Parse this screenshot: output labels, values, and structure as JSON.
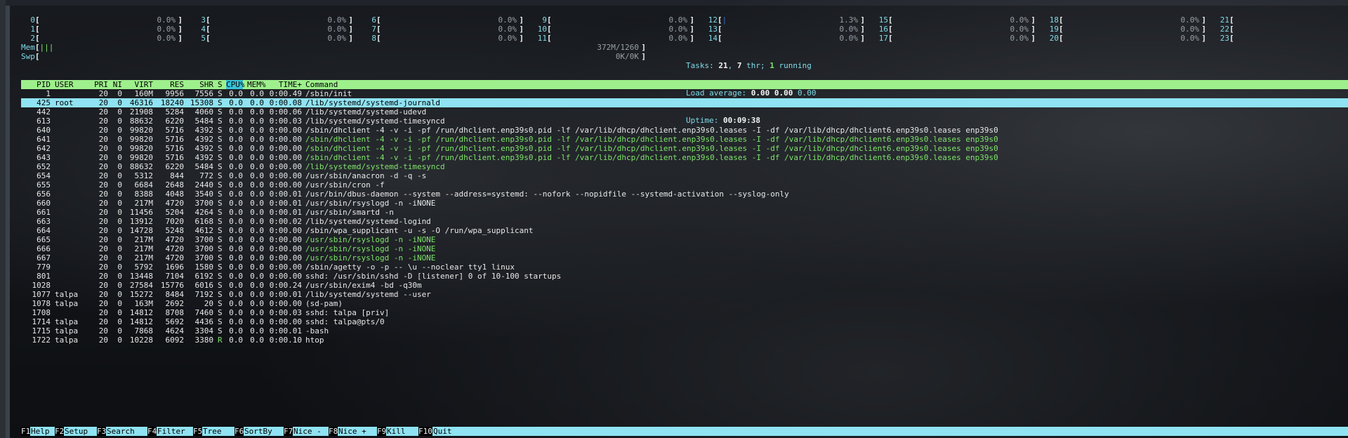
{
  "cpus": [
    {
      "id": "0",
      "val": "0.0%"
    },
    {
      "id": "1",
      "val": "0.0%"
    },
    {
      "id": "2",
      "val": "0.0%"
    },
    {
      "id": "3",
      "val": "0.0%"
    },
    {
      "id": "4",
      "val": "0.0%"
    },
    {
      "id": "5",
      "val": "0.0%"
    },
    {
      "id": "6",
      "val": "0.0%"
    },
    {
      "id": "7",
      "val": "0.0%"
    },
    {
      "id": "8",
      "val": "0.0%"
    },
    {
      "id": "9",
      "val": "0.0%"
    },
    {
      "id": "10",
      "val": "0.0%"
    },
    {
      "id": "11",
      "val": "0.0%"
    },
    {
      "id": "12",
      "val": "1.3%"
    },
    {
      "id": "13",
      "val": "0.0%"
    },
    {
      "id": "14",
      "val": "0.0%"
    },
    {
      "id": "15",
      "val": "0.0%"
    },
    {
      "id": "16",
      "val": "0.0%"
    },
    {
      "id": "17",
      "val": "0.0%"
    },
    {
      "id": "18",
      "val": "0.0%"
    },
    {
      "id": "19",
      "val": "0.0%"
    },
    {
      "id": "20",
      "val": "0.0%"
    },
    {
      "id": "21",
      "val": "0.0%"
    },
    {
      "id": "22",
      "val": "0.0%"
    },
    {
      "id": "23",
      "val": "0.0%"
    }
  ],
  "mem": {
    "label": "Mem",
    "bar": "|||",
    "val": "372M/1260"
  },
  "swp": {
    "label": "Swp",
    "val": "0K/0K"
  },
  "tasks": {
    "label": "Tasks:",
    "count": "21",
    "thr_count": "7",
    "thr_label": "thr;",
    "running": "1",
    "running_label": "running"
  },
  "load": {
    "label": "Load average:",
    "v1": "0.00",
    "v5": "0.00",
    "v15": "0.00"
  },
  "uptime": {
    "label": "Uptime:",
    "value": "00:09:38"
  },
  "columns": {
    "pid": "PID",
    "user": "USER",
    "pri": "PRI",
    "ni": "NI",
    "virt": "VIRT",
    "res": "RES",
    "shr": "SHR",
    "s": "S",
    "cpu": "CPU%",
    "mem": "MEM%",
    "time": "TIME+",
    "cmd": "Command"
  },
  "processes": [
    {
      "pid": "1",
      "user": "",
      "pri": "20",
      "ni": "0",
      "virt": "160M",
      "res": "9956",
      "shr": "7556",
      "s": "S",
      "cpu": "0.0",
      "mem": "0.0",
      "time": "0:00.49",
      "cmd": "/sbin/init"
    },
    {
      "pid": "425",
      "user": "root",
      "pri": "20",
      "ni": "0",
      "virt": "46316",
      "res": "18240",
      "shr": "15308",
      "s": "S",
      "cpu": "0.0",
      "mem": "0.0",
      "time": "0:00.08",
      "cmd": "/lib/systemd/systemd-journald"
    },
    {
      "pid": "442",
      "user": "",
      "pri": "20",
      "ni": "0",
      "virt": "21908",
      "res": "5284",
      "shr": "4060",
      "s": "S",
      "cpu": "0.0",
      "mem": "0.0",
      "time": "0:00.06",
      "cmd": "/lib/systemd/systemd-udevd"
    },
    {
      "pid": "613",
      "user": "",
      "pri": "20",
      "ni": "0",
      "virt": "88632",
      "res": "6220",
      "shr": "5484",
      "s": "S",
      "cpu": "0.0",
      "mem": "0.0",
      "time": "0:00.03",
      "cmd": "/lib/systemd/systemd-timesyncd"
    },
    {
      "pid": "640",
      "user": "",
      "pri": "20",
      "ni": "0",
      "virt": "99820",
      "res": "5716",
      "shr": "4392",
      "s": "S",
      "cpu": "0.0",
      "mem": "0.0",
      "time": "0:00.00",
      "cmd": "/sbin/dhclient -4 -v -i -pf /run/dhclient.enp39s0.pid -lf /var/lib/dhcp/dhclient.enp39s0.leases -I -df /var/lib/dhcp/dhclient6.enp39s0.leases enp39s0"
    },
    {
      "pid": "641",
      "user": "",
      "pri": "20",
      "ni": "0",
      "virt": "99820",
      "res": "5716",
      "shr": "4392",
      "s": "S",
      "cpu": "0.0",
      "mem": "0.0",
      "time": "0:00.00",
      "cmd": "/sbin/dhclient -4 -v -i -pf /run/dhclient.enp39s0.pid -lf /var/lib/dhcp/dhclient.enp39s0.leases -I -df /var/lib/dhcp/dhclient6.enp39s0.leases enp39s0"
    },
    {
      "pid": "642",
      "user": "",
      "pri": "20",
      "ni": "0",
      "virt": "99820",
      "res": "5716",
      "shr": "4392",
      "s": "S",
      "cpu": "0.0",
      "mem": "0.0",
      "time": "0:00.00",
      "cmd": "/sbin/dhclient -4 -v -i -pf /run/dhclient.enp39s0.pid -lf /var/lib/dhcp/dhclient.enp39s0.leases -I -df /var/lib/dhcp/dhclient6.enp39s0.leases enp39s0"
    },
    {
      "pid": "643",
      "user": "",
      "pri": "20",
      "ni": "0",
      "virt": "99820",
      "res": "5716",
      "shr": "4392",
      "s": "S",
      "cpu": "0.0",
      "mem": "0.0",
      "time": "0:00.00",
      "cmd": "/sbin/dhclient -4 -v -i -pf /run/dhclient.enp39s0.pid -lf /var/lib/dhcp/dhclient.enp39s0.leases -I -df /var/lib/dhcp/dhclient6.enp39s0.leases enp39s0"
    },
    {
      "pid": "652",
      "user": "",
      "pri": "20",
      "ni": "0",
      "virt": "88632",
      "res": "6220",
      "shr": "5484",
      "s": "S",
      "cpu": "0.0",
      "mem": "0.0",
      "time": "0:00.00",
      "cmd": "/lib/systemd/systemd-timesyncd"
    },
    {
      "pid": "654",
      "user": "",
      "pri": "20",
      "ni": "0",
      "virt": "5312",
      "res": "844",
      "shr": "772",
      "s": "S",
      "cpu": "0.0",
      "mem": "0.0",
      "time": "0:00.00",
      "cmd": "/usr/sbin/anacron -d -q -s"
    },
    {
      "pid": "655",
      "user": "",
      "pri": "20",
      "ni": "0",
      "virt": "6684",
      "res": "2648",
      "shr": "2440",
      "s": "S",
      "cpu": "0.0",
      "mem": "0.0",
      "time": "0:00.00",
      "cmd": "/usr/sbin/cron -f"
    },
    {
      "pid": "656",
      "user": "",
      "pri": "20",
      "ni": "0",
      "virt": "8388",
      "res": "4048",
      "shr": "3540",
      "s": "S",
      "cpu": "0.0",
      "mem": "0.0",
      "time": "0:00.01",
      "cmd": "/usr/bin/dbus-daemon --system --address=systemd: --nofork --nopidfile --systemd-activation --syslog-only"
    },
    {
      "pid": "660",
      "user": "",
      "pri": "20",
      "ni": "0",
      "virt": "217M",
      "res": "4720",
      "shr": "3700",
      "s": "S",
      "cpu": "0.0",
      "mem": "0.0",
      "time": "0:00.01",
      "cmd": "/usr/sbin/rsyslogd -n -iNONE"
    },
    {
      "pid": "661",
      "user": "",
      "pri": "20",
      "ni": "0",
      "virt": "11456",
      "res": "5204",
      "shr": "4264",
      "s": "S",
      "cpu": "0.0",
      "mem": "0.0",
      "time": "0:00.01",
      "cmd": "/usr/sbin/smartd -n"
    },
    {
      "pid": "663",
      "user": "",
      "pri": "20",
      "ni": "0",
      "virt": "13912",
      "res": "7020",
      "shr": "6168",
      "s": "S",
      "cpu": "0.0",
      "mem": "0.0",
      "time": "0:00.02",
      "cmd": "/lib/systemd/systemd-logind"
    },
    {
      "pid": "664",
      "user": "",
      "pri": "20",
      "ni": "0",
      "virt": "14728",
      "res": "5248",
      "shr": "4612",
      "s": "S",
      "cpu": "0.0",
      "mem": "0.0",
      "time": "0:00.00",
      "cmd": "/sbin/wpa_supplicant -u -s -O /run/wpa_supplicant"
    },
    {
      "pid": "665",
      "user": "",
      "pri": "20",
      "ni": "0",
      "virt": "217M",
      "res": "4720",
      "shr": "3700",
      "s": "S",
      "cpu": "0.0",
      "mem": "0.0",
      "time": "0:00.00",
      "cmd": "/usr/sbin/rsyslogd -n -iNONE"
    },
    {
      "pid": "666",
      "user": "",
      "pri": "20",
      "ni": "0",
      "virt": "217M",
      "res": "4720",
      "shr": "3700",
      "s": "S",
      "cpu": "0.0",
      "mem": "0.0",
      "time": "0:00.00",
      "cmd": "/usr/sbin/rsyslogd -n -iNONE"
    },
    {
      "pid": "667",
      "user": "",
      "pri": "20",
      "ni": "0",
      "virt": "217M",
      "res": "4720",
      "shr": "3700",
      "s": "S",
      "cpu": "0.0",
      "mem": "0.0",
      "time": "0:00.00",
      "cmd": "/usr/sbin/rsyslogd -n -iNONE"
    },
    {
      "pid": "779",
      "user": "",
      "pri": "20",
      "ni": "0",
      "virt": "5792",
      "res": "1696",
      "shr": "1580",
      "s": "S",
      "cpu": "0.0",
      "mem": "0.0",
      "time": "0:00.00",
      "cmd": "/sbin/agetty -o -p -- \\u --noclear tty1 linux"
    },
    {
      "pid": "801",
      "user": "",
      "pri": "20",
      "ni": "0",
      "virt": "13448",
      "res": "7104",
      "shr": "6192",
      "s": "S",
      "cpu": "0.0",
      "mem": "0.0",
      "time": "0:00.00",
      "cmd": "sshd: /usr/sbin/sshd -D [listener] 0 of 10-100 startups"
    },
    {
      "pid": "1028",
      "user": "",
      "pri": "20",
      "ni": "0",
      "virt": "27584",
      "res": "15776",
      "shr": "6016",
      "s": "S",
      "cpu": "0.0",
      "mem": "0.0",
      "time": "0:00.24",
      "cmd": "/usr/sbin/exim4 -bd -q30m"
    },
    {
      "pid": "1077",
      "user": "talpa",
      "pri": "20",
      "ni": "0",
      "virt": "15272",
      "res": "8484",
      "shr": "7192",
      "s": "S",
      "cpu": "0.0",
      "mem": "0.0",
      "time": "0:00.01",
      "cmd": "/lib/systemd/systemd --user"
    },
    {
      "pid": "1078",
      "user": "talpa",
      "pri": "20",
      "ni": "0",
      "virt": "163M",
      "res": "2692",
      "shr": "20",
      "s": "S",
      "cpu": "0.0",
      "mem": "0.0",
      "time": "0:00.00",
      "cmd": "(sd-pam)"
    },
    {
      "pid": "1708",
      "user": "",
      "pri": "20",
      "ni": "0",
      "virt": "14812",
      "res": "8708",
      "shr": "7460",
      "s": "S",
      "cpu": "0.0",
      "mem": "0.0",
      "time": "0:00.03",
      "cmd": "sshd: talpa [priv]"
    },
    {
      "pid": "1714",
      "user": "talpa",
      "pri": "20",
      "ni": "0",
      "virt": "14812",
      "res": "5692",
      "shr": "4436",
      "s": "S",
      "cpu": "0.0",
      "mem": "0.0",
      "time": "0:00.00",
      "cmd": "sshd: talpa@pts/0"
    },
    {
      "pid": "1715",
      "user": "talpa",
      "pri": "20",
      "ni": "0",
      "virt": "7868",
      "res": "4624",
      "shr": "3304",
      "s": "S",
      "cpu": "0.0",
      "mem": "0.0",
      "time": "0:00.01",
      "cmd": "-bash"
    },
    {
      "pid": "1722",
      "user": "talpa",
      "pri": "20",
      "ni": "0",
      "virt": "10228",
      "res": "6092",
      "shr": "3380",
      "s": "R",
      "cpu": "0.0",
      "mem": "0.0",
      "time": "0:00.10",
      "cmd": "htop"
    }
  ],
  "footer": [
    {
      "key": "F1",
      "label": "Help"
    },
    {
      "key": "F2",
      "label": "Setup"
    },
    {
      "key": "F3",
      "label": "Search"
    },
    {
      "key": "F4",
      "label": "Filter"
    },
    {
      "key": "F5",
      "label": "Tree"
    },
    {
      "key": "F6",
      "label": "SortBy"
    },
    {
      "key": "F7",
      "label": "Nice -"
    },
    {
      "key": "F8",
      "label": "Nice +"
    },
    {
      "key": "F9",
      "label": "Kill"
    },
    {
      "key": "F10",
      "label": "Quit"
    }
  ],
  "colors": {
    "header_bg": "#9ef08c",
    "selected_bg": "#8fe3f2",
    "footer_bg": "#8fe3f2",
    "label_cyan": "#7fdbe8",
    "thread_green": "#7fe36a"
  }
}
